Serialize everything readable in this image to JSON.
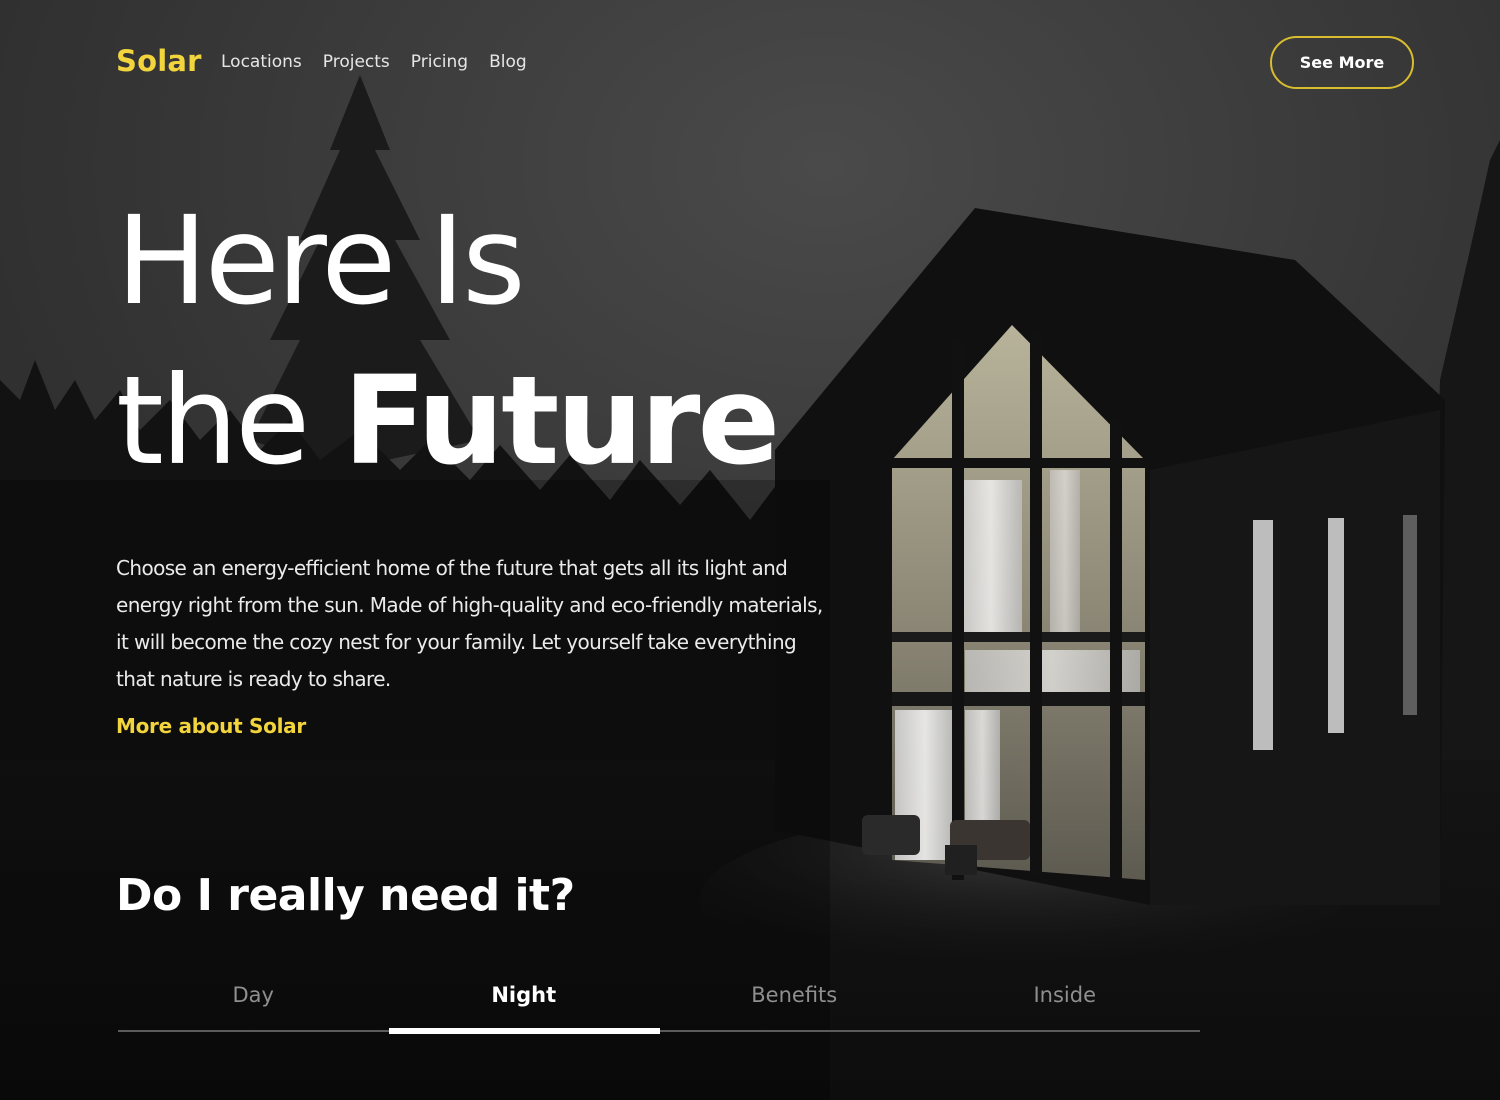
{
  "brand": {
    "logo": "Solar",
    "accent": "#f2d43c"
  },
  "nav": {
    "items": [
      "Locations",
      "Projects",
      "Pricing",
      "Blog"
    ],
    "cta_label": "See More"
  },
  "hero": {
    "line1": "Here Is",
    "line2_light": "the ",
    "line2_bold": "Future",
    "description": "Choose an energy-efficient home of the future that gets all its light and energy right from the sun. Made of high-quality and eco-friendly materials, it will become the cozy nest for your family. Let yourself take everything that nature is ready to share.",
    "link_label": "More about Solar"
  },
  "section": {
    "question": "Do I really need it?",
    "tabs": [
      "Day",
      "Night",
      "Benefits",
      "Inside"
    ],
    "active_tab": "Night"
  }
}
